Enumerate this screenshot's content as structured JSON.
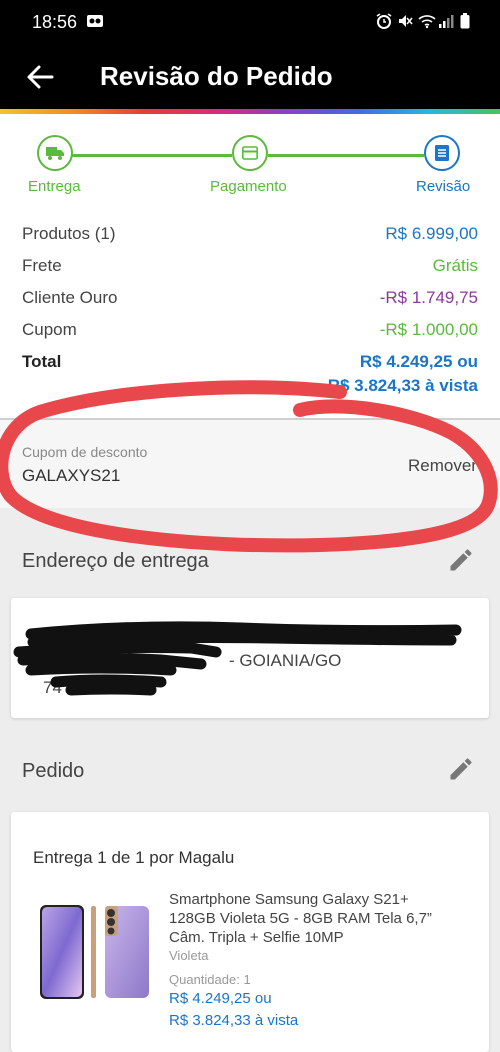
{
  "status_bar": {
    "time": "18:56"
  },
  "header": {
    "title": "Revisão do Pedido"
  },
  "steps": [
    {
      "label": "Entrega",
      "state": "done"
    },
    {
      "label": "Pagamento",
      "state": "done"
    },
    {
      "label": "Revisão",
      "state": "active"
    }
  ],
  "summary": {
    "products_label": "Produtos (1)",
    "products_value": "R$ 6.999,00",
    "shipping_label": "Frete",
    "shipping_value": "Grátis",
    "gold_label": "Cliente Ouro",
    "gold_value": "-R$ 1.749,75",
    "coupon_label": "Cupom",
    "coupon_value": "-R$ 1.000,00",
    "total_label": "Total",
    "total_installments": "R$ 4.249,25 ou",
    "total_cash": "R$ 3.824,33 à vista"
  },
  "coupon_box": {
    "label": "Cupom de desconto",
    "code": "GALAXYS21",
    "remove_label": "Remover"
  },
  "address": {
    "section_title": "Endereço de entrega",
    "city": "- GOIANIA/GO",
    "zip": "74"
  },
  "order": {
    "section_title": "Pedido",
    "delivery_header": "Entrega 1 de 1 por Magalu",
    "product_name": "Smartphone Samsung Galaxy S21+ 128GB Violeta 5G - 8GB RAM Tela 6,7” Câm. Tripla + Selfie 10MP",
    "product_color": "Violeta",
    "quantity": "Quantidade:  1",
    "price_installments": "R$ 4.249,25 ou",
    "price_cash": "R$ 3.824,33 à vista"
  },
  "colors": {
    "accent_blue": "#1b75c8",
    "accent_green": "#5bb93b",
    "purple": "#8a3a9c",
    "annotation_red": "#e8474b"
  }
}
